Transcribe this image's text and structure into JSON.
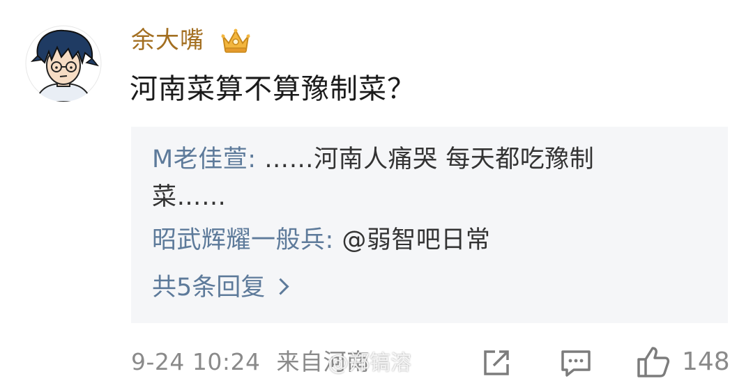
{
  "post": {
    "username": "余大嘴",
    "text": "河南菜算不算豫制菜？",
    "timestamp": "9-24 10:24",
    "source": "来自河南",
    "likes": "148"
  },
  "replies": [
    {
      "author": "M老佳萱:",
      "text": " ……河南人痛哭 每天都吃豫制菜……"
    },
    {
      "author": "昭武辉耀一般兵:",
      "text": " @弱智吧日常"
    }
  ],
  "more_replies_label": "共5条回复",
  "watermark": "@郑镐溶",
  "icons": {
    "avatar": "anime-boy-avatar",
    "badge": "crown-icon",
    "share": "share-icon",
    "comment": "comment-icon",
    "like": "thumbs-up-icon"
  },
  "colors": {
    "username": "#a36f21",
    "reply_author": "#5d7a9a",
    "meta": "#8a8a8a",
    "reply_bg": "#f5f6f8"
  }
}
